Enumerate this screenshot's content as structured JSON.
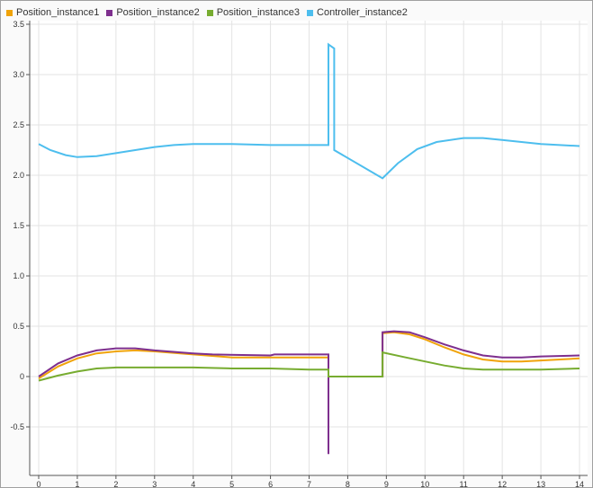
{
  "chart_data": {
    "type": "line",
    "title": "",
    "xlabel": "",
    "ylabel": "",
    "xlim": [
      -0.2,
      14.2
    ],
    "ylim": [
      -0.98,
      3.53
    ],
    "xticks": [
      0,
      1,
      2,
      3,
      4,
      5,
      6,
      7,
      8,
      9,
      10,
      11,
      12,
      13,
      14
    ],
    "yticks": [
      -0.5,
      0,
      0.5,
      1.0,
      1.5,
      2.0,
      2.5,
      3.0,
      3.5
    ],
    "ytick_labels": [
      "-0.5",
      "0",
      "0.5",
      "1.0",
      "1.5",
      "2.0",
      "2.5",
      "3.0",
      "3.5"
    ],
    "grid": true,
    "legend_position": "top-left",
    "series": [
      {
        "name": "Position_instance1",
        "color": "#f0a30a",
        "x": [
          0,
          0.5,
          1,
          1.5,
          2,
          2.5,
          3,
          4,
          5,
          6,
          7,
          7.5,
          7.5,
          8.9,
          8.9,
          9.2,
          9.6,
          10,
          10.5,
          11,
          11.5,
          12,
          12.5,
          13,
          14
        ],
        "y": [
          -0.02,
          0.1,
          0.18,
          0.23,
          0.25,
          0.26,
          0.25,
          0.22,
          0.19,
          0.19,
          0.19,
          0.19,
          0,
          0,
          0.43,
          0.44,
          0.42,
          0.37,
          0.29,
          0.22,
          0.17,
          0.15,
          0.15,
          0.16,
          0.18
        ]
      },
      {
        "name": "Position_instance2",
        "color": "#7e2f8e",
        "x": [
          0,
          0.5,
          1,
          1.5,
          2,
          2.5,
          3,
          4,
          4.5,
          6,
          6.1,
          7,
          7.5,
          7.5,
          7.5,
          8.9,
          8.9,
          9.2,
          9.6,
          10,
          10.5,
          11,
          11.5,
          12,
          12.5,
          13,
          14
        ],
        "y": [
          0,
          0.13,
          0.21,
          0.26,
          0.28,
          0.28,
          0.26,
          0.23,
          0.22,
          0.21,
          0.22,
          0.22,
          0.22,
          -0.77,
          0,
          0,
          0.44,
          0.45,
          0.44,
          0.39,
          0.32,
          0.26,
          0.21,
          0.19,
          0.19,
          0.2,
          0.21
        ]
      },
      {
        "name": "Position_instance3",
        "color": "#77ac30",
        "x": [
          0,
          0.5,
          1,
          1.5,
          2,
          3,
          4,
          5,
          6,
          7,
          7.5,
          7.5,
          8.9,
          8.9,
          9.5,
          10,
          10.5,
          11,
          11.5,
          12,
          13,
          14
        ],
        "y": [
          -0.04,
          0.01,
          0.05,
          0.08,
          0.09,
          0.09,
          0.09,
          0.08,
          0.08,
          0.07,
          0.07,
          0,
          0,
          0.24,
          0.19,
          0.15,
          0.11,
          0.08,
          0.07,
          0.07,
          0.07,
          0.08
        ]
      },
      {
        "name": "Controller_instance2",
        "color": "#4dbeee",
        "x": [
          0,
          0.3,
          0.7,
          1,
          1.5,
          2,
          2.5,
          3,
          3.5,
          4,
          5,
          6,
          7,
          7.5,
          7.5,
          7.65,
          7.65,
          8.9,
          9.3,
          9.8,
          10.3,
          11,
          11.5,
          12,
          13,
          14
        ],
        "y": [
          2.31,
          2.25,
          2.2,
          2.18,
          2.19,
          2.22,
          2.25,
          2.28,
          2.3,
          2.31,
          2.31,
          2.3,
          2.3,
          2.3,
          3.3,
          3.26,
          2.25,
          1.97,
          2.12,
          2.26,
          2.33,
          2.37,
          2.37,
          2.35,
          2.31,
          2.29
        ]
      }
    ]
  }
}
